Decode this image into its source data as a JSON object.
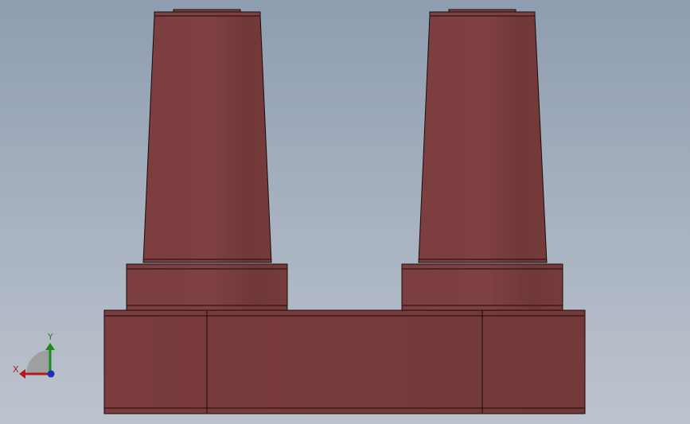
{
  "viewport": {
    "background_top": "#8e9db0",
    "background_bottom": "#bcc3cd"
  },
  "model": {
    "body_color": "#7a3c3c",
    "body_shadow": "#6e3434",
    "edge_color": "#1a0c0c"
  },
  "triad": {
    "x_label": "X",
    "y_label": "Y",
    "x_color": "#b01c1c",
    "y_color": "#1e8a1e",
    "z_color": "#1c2fb0"
  }
}
